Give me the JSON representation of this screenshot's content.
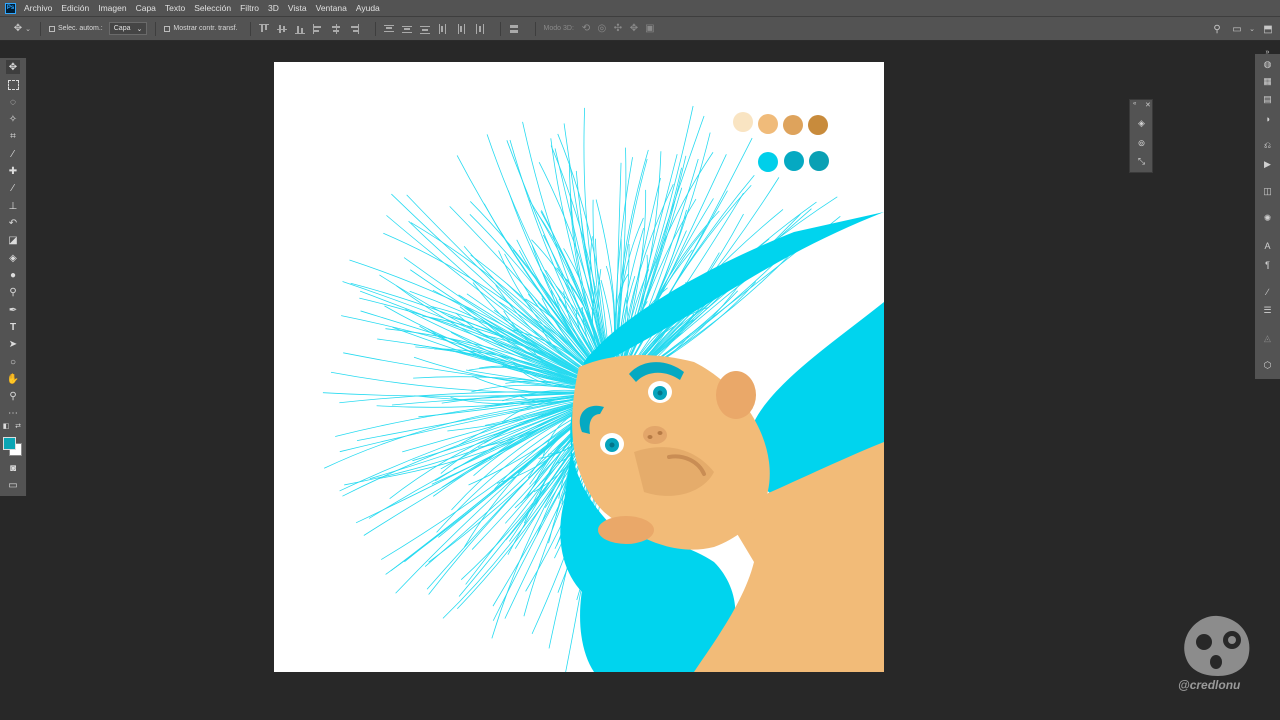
{
  "app": {
    "logo_text": "Ps"
  },
  "menu": [
    "Archivo",
    "Edición",
    "Imagen",
    "Capa",
    "Texto",
    "Selección",
    "Filtro",
    "3D",
    "Vista",
    "Ventana",
    "Ayuda"
  ],
  "options": {
    "auto_select_label": "Selec. autom.:",
    "auto_select_value": "Capa",
    "show_transform_label": "Mostrar contr. transf.",
    "mode_3d_label": "Modo 3D:"
  },
  "canvas": {
    "skin_swatches": [
      "#f9e4c2",
      "#f0bb7a",
      "#dea35c",
      "#c88b3c"
    ],
    "hair_swatches": [
      "#00cfea",
      "#05a9c2",
      "#0aa0b4"
    ],
    "hair_color": "#00d4ee",
    "skin_color": "#f2bb78"
  },
  "colors": {
    "foreground": "#0aa5b4",
    "background": "#ffffff"
  },
  "watermark": {
    "text": "@credlonu"
  }
}
